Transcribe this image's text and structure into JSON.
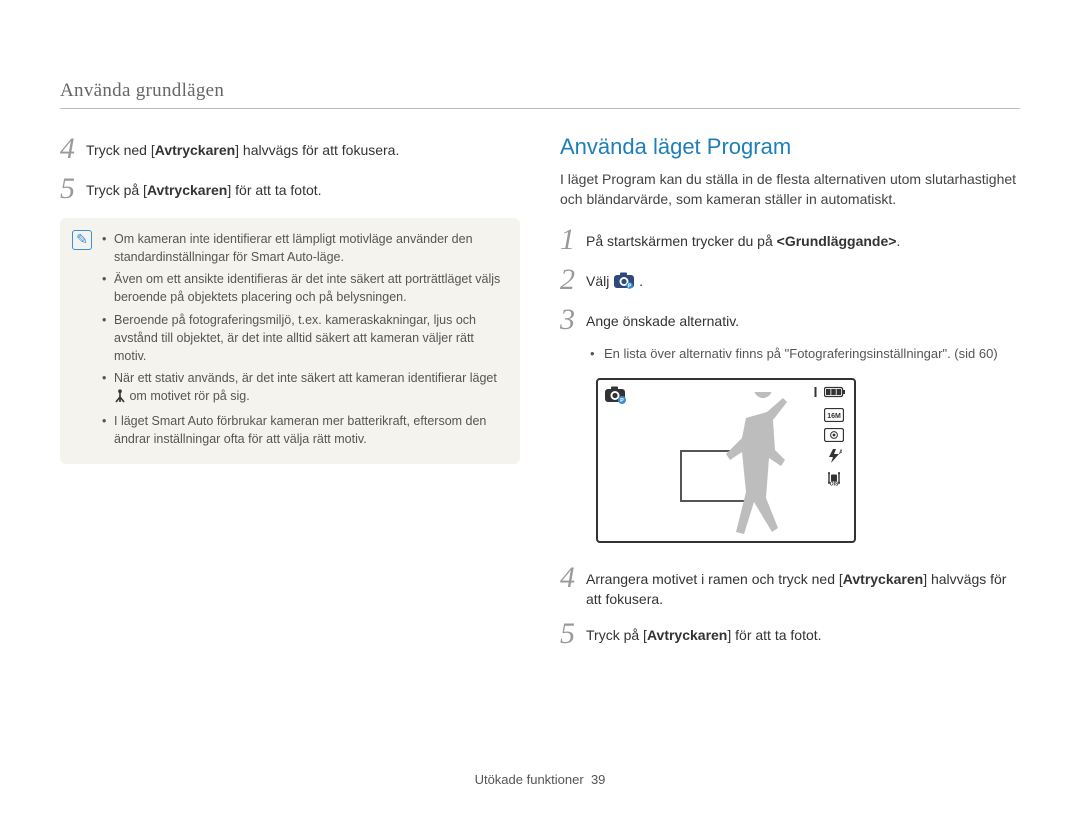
{
  "breadcrumb": "Använda grundlägen",
  "left": {
    "step4_pre": "Tryck ned [",
    "step4_bold": "Avtryckaren",
    "step4_post": "] halvvägs för att fokusera.",
    "step5_pre": "Tryck på [",
    "step5_bold": "Avtryckaren",
    "step5_post": "] för att ta fotot.",
    "note_icon": "✎",
    "notes": {
      "n1": "Om kameran inte identifierar ett lämpligt motivläge använder den standardinställningar för Smart Auto-läge.",
      "n2": "Även om ett ansikte identifieras är det inte säkert att porträttläget väljs beroende på objektets placering och på belysningen.",
      "n3": "Beroende på fotograferingsmiljö, t.ex. kameraskakningar, ljus och avstånd till objektet, är det inte alltid säkert att kameran väljer rätt motiv.",
      "n4_pre": "När ett stativ används, är det inte säkert att kameran identifierar läget ",
      "n4_post": " om motivet rör på sig.",
      "n5": "I läget Smart Auto förbrukar kameran mer batterikraft, eftersom den ändrar inställningar ofta för att välja rätt motiv."
    }
  },
  "right": {
    "heading": "Använda läget Program",
    "intro": "I läget Program kan du ställa in de flesta alternativen utom slutarhastighet och bländarvärde, som kameran ställer in automatiskt.",
    "step1_pre": "På startskärmen trycker du på ",
    "step1_bold": "<Grundläggande>",
    "step1_post": ".",
    "step2_pre": "Välj ",
    "step2_post": ".",
    "step3": "Ange önskade alternativ.",
    "step3_bullet": "En lista över alternativ finns på \"Fotograferingsinställningar\". (sid 60)",
    "step4_pre": "Arrangera motivet i ramen och tryck ned [",
    "step4_bold": "Avtryckaren",
    "step4_post": "] halvvägs för att fokusera.",
    "step5_pre": "Tryck på [",
    "step5_bold": "Avtryckaren",
    "step5_post": "] för att ta fotot."
  },
  "nums": {
    "_1": "1",
    "_2": "2",
    "_3": "3",
    "_4": "4",
    "_5": "5"
  },
  "footer_label": "Utökade funktioner",
  "footer_page": "39"
}
